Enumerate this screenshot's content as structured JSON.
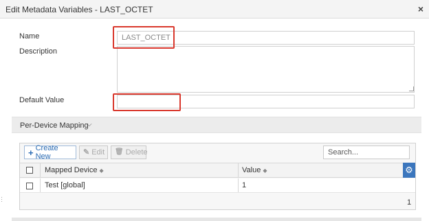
{
  "dialog": {
    "title": "Edit Metadata Variables - LAST_OCTET",
    "close_glyph": "×"
  },
  "form": {
    "name_label": "Name",
    "name_value": "LAST_OCTET",
    "description_label": "Description",
    "description_value": "",
    "default_value_label": "Default Value",
    "default_value_value": ""
  },
  "mapping": {
    "section_label": "Per-Device Mapping",
    "chevron_glyph": "⌵",
    "toolbar": {
      "create_new": "Create New",
      "edit": "Edit",
      "delete": "Delete"
    },
    "search_placeholder": "Search...",
    "columns": [
      "Mapped Device",
      "Value"
    ],
    "sort_glyph": "◆",
    "rows": [
      {
        "device": "Test [global]",
        "value": "1"
      }
    ],
    "count": "1"
  },
  "colors": {
    "highlight": "#d9372c",
    "accent": "#2a6bb3",
    "gear_bg": "#3b76bd"
  }
}
